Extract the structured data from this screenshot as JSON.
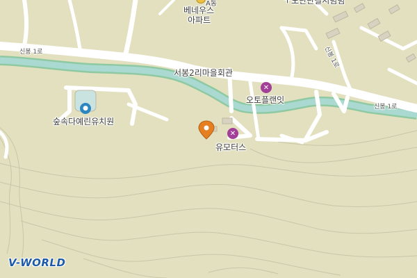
{
  "map": {
    "labels": {
      "apartment_top": "A동",
      "apartment_name": "베네우스",
      "apartment_sub": "아파트",
      "top_right_partial": "ㅜ노단단길시텀텀",
      "village_hall": "서봉2리마을회관",
      "kindergarten": "숲속다예린유치원",
      "auto_plant": "오토플랜잇",
      "u_motors": "유모터스",
      "road_left": "신봉 1로",
      "road_right": "신봉 1로",
      "road_top_right": "신봉 1로"
    },
    "logo": {
      "text": "V-WORLD"
    },
    "colors": {
      "land": "#e2e0bf",
      "road": "#ffffff",
      "stream": "#a9d9d0",
      "stream_edge": "#8fc9a2",
      "contour": "#c9c6a8",
      "poi_service": "#a23f98",
      "poi_kinder": "#2e86c1",
      "marker": "#e67e22",
      "logo_blue": "#1e5aa8"
    },
    "icons": {
      "auto_plant": "wrench-screwdriver-icon",
      "u_motors": "wrench-screwdriver-icon",
      "kindergarten": "duck-icon",
      "selected": "location-pin-icon"
    }
  }
}
